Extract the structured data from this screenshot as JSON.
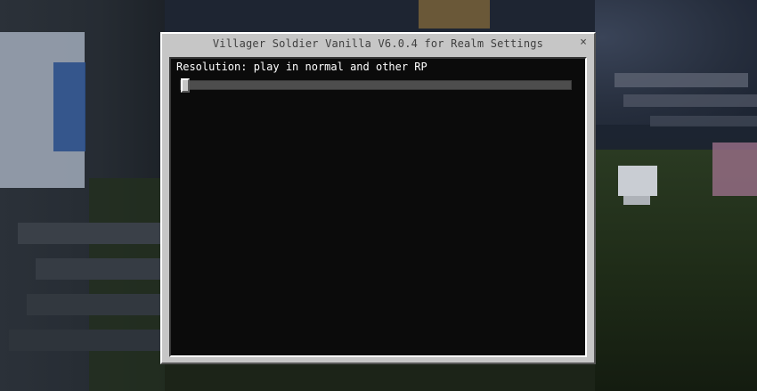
{
  "dialog": {
    "title": "Villager Soldier Vanilla V6.0.4  for Realm Settings",
    "close_icon": "close-icon",
    "close_glyph": "×"
  },
  "settings": [
    {
      "label": "Resolution: play in normal and other RP",
      "slider_value": 0.0
    }
  ],
  "colors": {
    "dialog_background": "#c6c6c6",
    "content_background": "#0b0b0b",
    "slider_track": "#4d4d4d",
    "slider_thumb": "#c6c6c6",
    "label_text": "#ffffff",
    "title_text": "#3f3f3f"
  }
}
